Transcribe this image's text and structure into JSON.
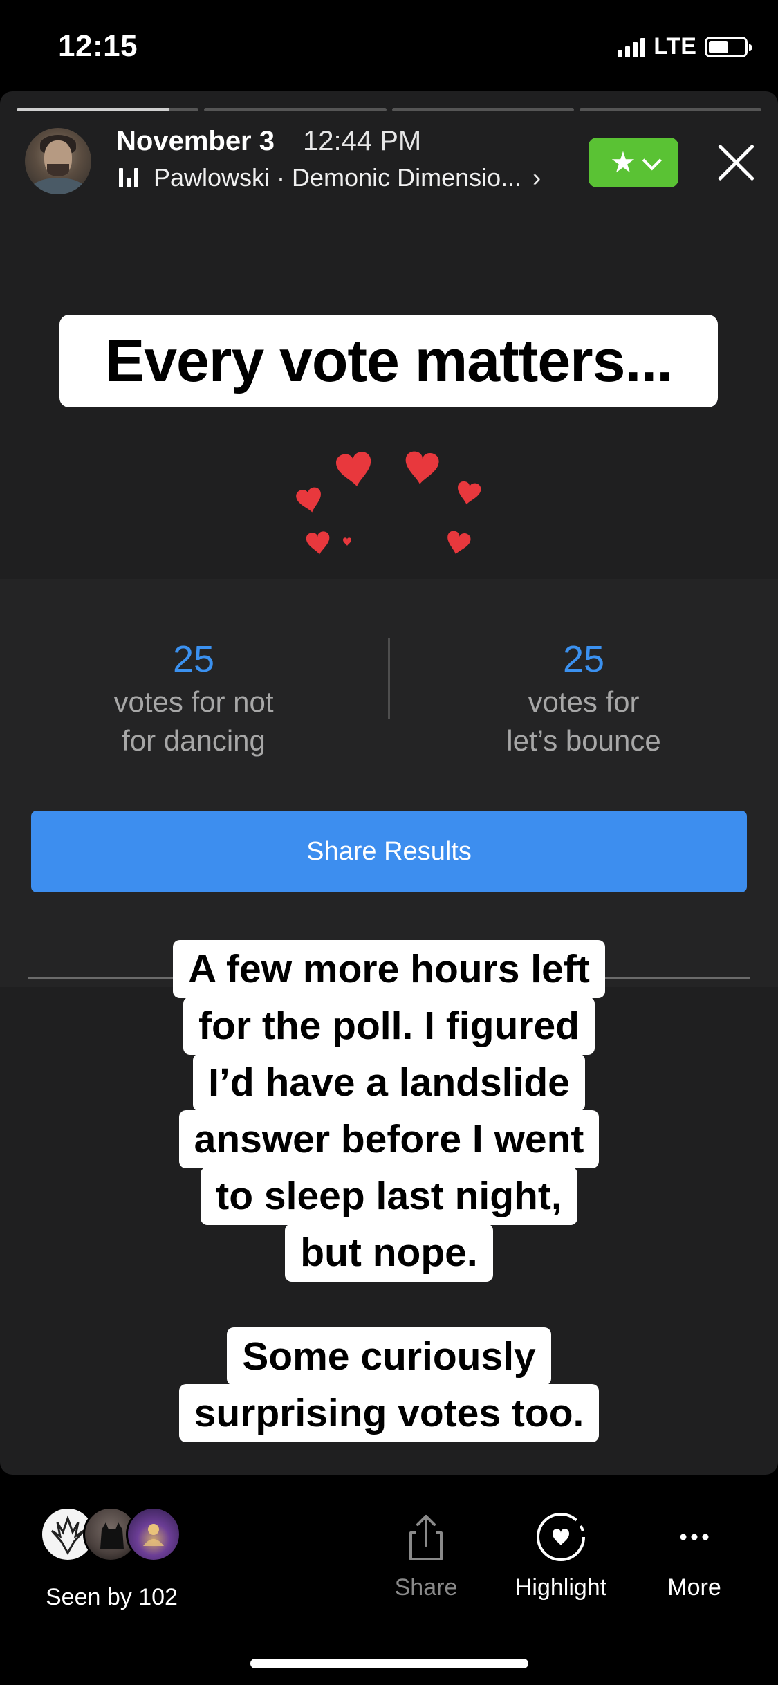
{
  "status_bar": {
    "time": "12:15",
    "network": "LTE",
    "battery_level": 0.55
  },
  "story": {
    "progress": [
      1.0,
      0.0,
      0.0,
      0.0
    ],
    "progress_active_fraction": 0.84,
    "header": {
      "date": "November 3",
      "time": "12:44 PM",
      "music_text": "Pawlowski · Demonic Dimensio...",
      "music_chevron": "›",
      "close_friends_icon": "star-icon",
      "close_icon": "close-icon"
    },
    "banner_text": "Every vote matters...",
    "hearts_color": "#e8383d",
    "poll": {
      "left": {
        "count": "25",
        "label_line1": "votes for not",
        "label_line2": "for dancing"
      },
      "right": {
        "count": "25",
        "label_line1": "votes for",
        "label_line2": "let’s bounce"
      },
      "share_button": "Share Results",
      "count_color": "#3b91f0",
      "button_color": "#3d8eef"
    },
    "caption1": [
      "A few more hours left",
      "for the poll. I figured",
      "I’d have a landslide",
      "answer before I went",
      "to sleep last night,",
      "but nope."
    ],
    "caption2": [
      "Some curiously",
      "surprising votes too."
    ]
  },
  "bottom_bar": {
    "seen_by": "Seen by 102",
    "actions": {
      "share": "Share",
      "highlight": "Highlight",
      "more": "More"
    }
  },
  "colors": {
    "close_friends_green": "#5ac234",
    "background": "#000000",
    "story_background": "#1f1f20"
  }
}
